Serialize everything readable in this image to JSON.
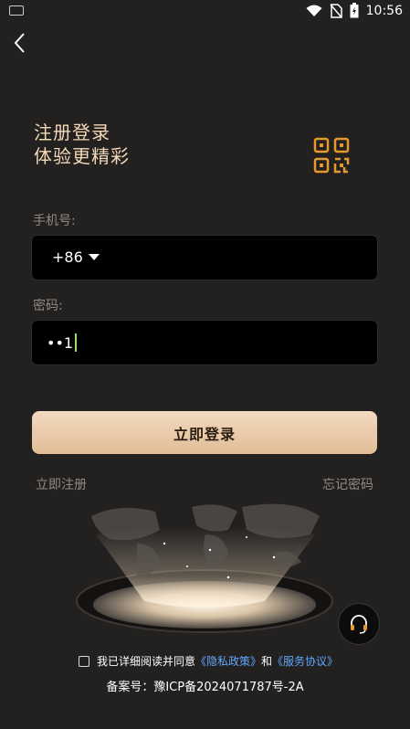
{
  "status": {
    "time": "10:56"
  },
  "header": {
    "title_line1": "注册登录",
    "title_line2": "体验更精彩"
  },
  "phone": {
    "label": "手机号:",
    "country_code": "+86"
  },
  "password": {
    "label": "密码:",
    "value": "••1"
  },
  "login_button": "立即登录",
  "links": {
    "register": "立即注册",
    "forgot": "忘记密码"
  },
  "agreement": {
    "prefix": "我已详细阅读并同意",
    "privacy": "《隐私政策》",
    "and": "和",
    "service": "《服务协议》"
  },
  "icp": "备案号：豫ICP备2024071787号-2A",
  "colors": {
    "accent": "#f3d9b7",
    "link": "#5fa8ff",
    "background": "#232120"
  },
  "icons": [
    "keyboard-icon",
    "wifi-icon",
    "no-sim-icon",
    "battery-icon",
    "back-icon",
    "qr-code-icon",
    "dropdown-icon",
    "headset-icon",
    "checkbox-icon"
  ]
}
